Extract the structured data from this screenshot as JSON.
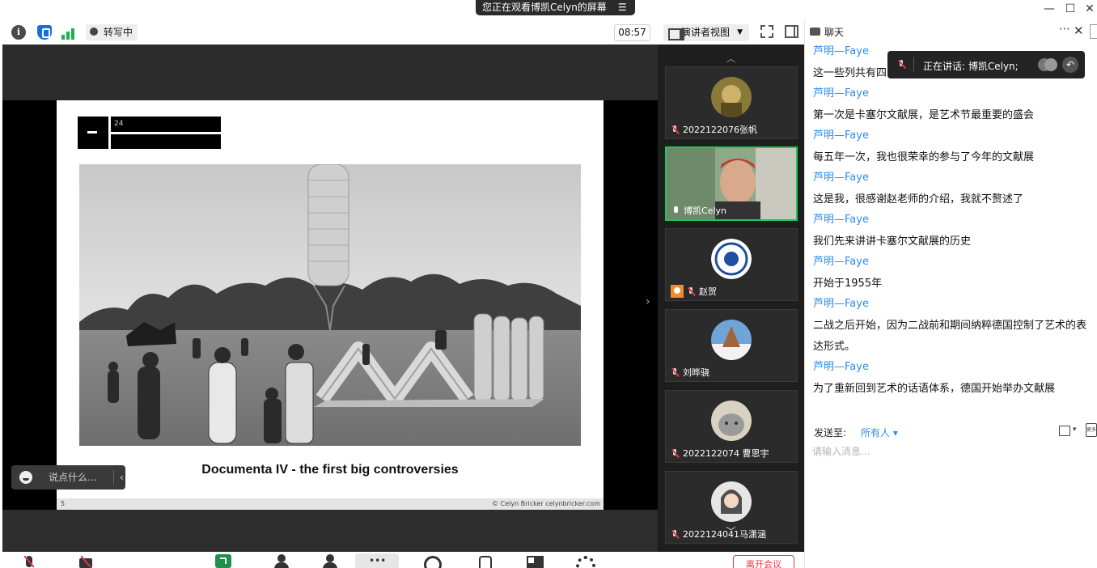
{
  "window": {
    "share_banner": "您正在观看博凯Celyn的屏幕",
    "controls": [
      "—",
      "☐",
      "✕"
    ]
  },
  "toolbar": {
    "transcribe_label": "转写中",
    "timer": "08:57",
    "view_label": "演讲者视图"
  },
  "slide": {
    "header_text": "24",
    "caption": "Documenta IV - the first big controversies",
    "page_number": "5",
    "copyright": "© Celyn Bricker  celynbricker.com"
  },
  "reaction_bar": {
    "placeholder": "说点什么..."
  },
  "participants": [
    {
      "name": "2022122076张帆",
      "muted": true,
      "active": false,
      "avatar": "user-avatar-dark"
    },
    {
      "name": "博凯Celyn",
      "muted": false,
      "active": true,
      "avatar": "speaker-video"
    },
    {
      "name": "赵贺",
      "muted": true,
      "active": false,
      "host": true,
      "avatar": "university-logo"
    },
    {
      "name": "刘晔骁",
      "muted": true,
      "active": false,
      "avatar": "winter-tree"
    },
    {
      "name": "2022122074 曹思宇",
      "muted": true,
      "active": false,
      "avatar": "grey-cat"
    },
    {
      "name": "2022124041马潇涵",
      "muted": true,
      "active": false,
      "avatar": "girl-portrait"
    }
  ],
  "bottom_bar": {
    "leave_label": "离开会议"
  },
  "chat": {
    "title": "聊天",
    "speaking_label": "正在讲话: 博凯Celyn;",
    "messages": [
      {
        "sender": "芦明—Faye",
        "text": "这一些列共有四"
      },
      {
        "sender": "芦明—Faye",
        "text": "第一次是卡塞尔文献展，是艺术节最重要的盛会"
      },
      {
        "sender": "芦明—Faye",
        "text": "每五年一次，我也很荣幸的参与了今年的文献展"
      },
      {
        "sender": "芦明—Faye",
        "text": "这是我，很感谢赵老师的介绍，我就不赘述了"
      },
      {
        "sender": "芦明—Faye",
        "text": "我们先来讲讲卡塞尔文献展的历史"
      },
      {
        "sender": "芦明—Faye",
        "text": "开始于1955年"
      },
      {
        "sender": "芦明—Faye",
        "text": "二战之后开始，因为二战前和期间纳粹德国控制了艺术的表达形式。"
      },
      {
        "sender": "芦明—Faye",
        "text": "为了重新回到艺术的话语体系，德国开始举办文献展"
      }
    ],
    "send_to_label": "发送至:",
    "send_to_target": "所有人",
    "more_label": "更多",
    "input_placeholder": "请输入消息..."
  }
}
